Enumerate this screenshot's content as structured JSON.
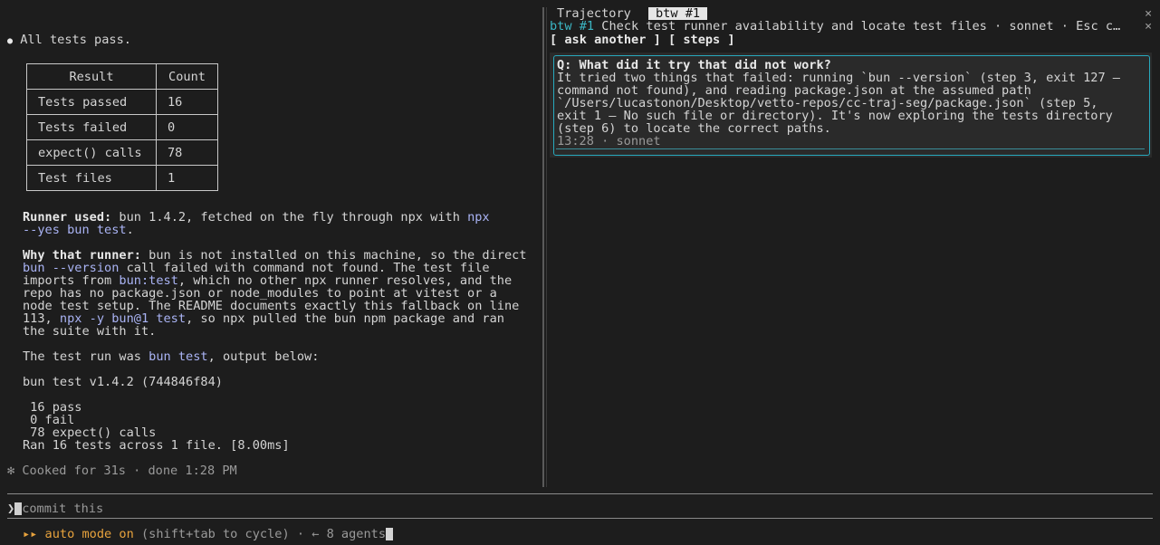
{
  "main": {
    "status_bullet": "●",
    "status_text": "All tests pass.",
    "table": {
      "headers": [
        "Result",
        "Count"
      ],
      "rows": [
        [
          "Tests passed",
          "16"
        ],
        [
          "Tests failed",
          "0"
        ],
        [
          "expect() calls",
          "78"
        ],
        [
          "Test files",
          "1"
        ]
      ]
    },
    "runner_used": {
      "label": "Runner used:",
      "text": " bun 1.4.2, fetched on the fly through npx with ",
      "code1": "npx",
      "code2": "--yes bun test",
      "end": "."
    },
    "why_runner": {
      "label": "Why that runner:",
      "l1": " bun is not installed on this machine, so the direct",
      "l2_code": "bun --version",
      "l2": " call failed with command not found. The test file",
      "l3_pre": "imports from ",
      "l3_code": "bun:test",
      "l3": ", which no other npx runner resolves, and the",
      "l4": "repo has no package.json or node_modules to point at vitest or a",
      "l5": "node test setup. The README documents exactly this fallback on line",
      "l6_pre": "113, ",
      "l6_code": "npx -y bun@1 test",
      "l6": ", so npx pulled the bun npm package and ran",
      "l7": "the suite with it."
    },
    "run_line": {
      "pre": "The test run was ",
      "code": "bun test",
      "post": ", output below:"
    },
    "output": {
      "header": "bun test v1.4.2 (744846f84)",
      "pass": " 16 pass",
      "fail": " 0 fail",
      "calls": " 78 expect() calls",
      "summary": "Ran 16 tests across 1 file. [8.00ms]"
    },
    "cooked": "✻ Cooked for 31s · done 1:28 PM"
  },
  "side_panel": {
    "tab_trajectory": "Trajectory",
    "tab_btw": "btw #1",
    "close_icon": "×",
    "btw_label": "btw #1",
    "btw_title": " Check test runner availability and locate test files · sonnet · Esc c…",
    "ask_another": "[ ask another ]",
    "steps": "[ steps ]",
    "question": "Q: What did it try that did not work?",
    "answer": [
      "It tried two things that failed: running `bun --version` (step 3, exit 127 —",
      "command not found), and reading package.json at the assumed path",
      "`/Users/lucastonon/Desktop/vetto-repos/cc-traj-seg/package.json` (step 5,",
      "exit 1 — No such file or directory). It's now exploring the tests directory",
      "(step 6) to locate the correct paths."
    ],
    "meta": "13:28 · sonnet"
  },
  "prompt": {
    "caret": "❯",
    "placeholder": "commit this"
  },
  "footer": {
    "arrows": "▸▸",
    "mode": " auto mode on",
    "hint": " (shift+tab to cycle) · ← 8 agents"
  }
}
